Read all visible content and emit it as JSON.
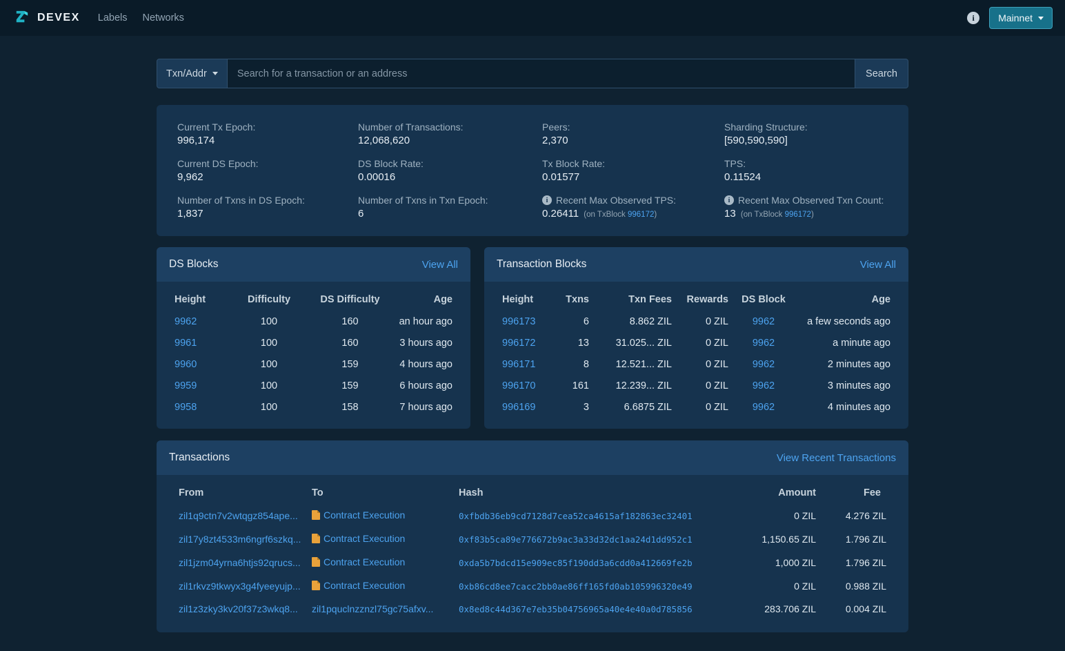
{
  "colors": {
    "accent_link": "#4da3ef",
    "network_button": "#17718a",
    "contract_icon": "#e9a23b",
    "card_bg": "#16334e",
    "card_header_bg": "#1d4062"
  },
  "navbar": {
    "brand": "DEVEX",
    "links": [
      {
        "label": "Labels"
      },
      {
        "label": "Networks"
      }
    ],
    "info_icon": "info-circle-icon",
    "network_button": "Mainnet"
  },
  "search": {
    "filter_label": "Txn/Addr",
    "placeholder": "Search for a transaction or an address",
    "button_label": "Search"
  },
  "stats": {
    "cells": [
      {
        "label": "Current Tx Epoch:",
        "value": "996,174"
      },
      {
        "label": "Number of Transactions:",
        "value": "12,068,620"
      },
      {
        "label": "Peers:",
        "value": "2,370"
      },
      {
        "label": "Sharding Structure:",
        "value": "[590,590,590]"
      },
      {
        "label": "Current DS Epoch:",
        "value": "9,962"
      },
      {
        "label": "DS Block Rate:",
        "value": "0.00016"
      },
      {
        "label": "Tx Block Rate:",
        "value": "0.01577"
      },
      {
        "label": "TPS:",
        "value": "0.11524"
      },
      {
        "label": "Number of Txns in DS Epoch:",
        "value": "1,837"
      },
      {
        "label": "Number of Txns in Txn Epoch:",
        "value": "6"
      },
      {
        "label": "Recent Max Observed TPS:",
        "value": "0.26411",
        "note_pre": "(on TxBlock",
        "note_link": "996172",
        "note_post": ")"
      },
      {
        "label": "Recent Max Observed Txn Count:",
        "value": "13",
        "note_pre": "(on TxBlock",
        "note_link": "996172",
        "note_post": ")"
      }
    ]
  },
  "ds_blocks": {
    "title": "DS Blocks",
    "view_all": "View All",
    "columns": [
      "Height",
      "Difficulty",
      "DS Difficulty",
      "Age"
    ],
    "rows": [
      {
        "height": "9962",
        "difficulty": "100",
        "ds_difficulty": "160",
        "age": "an hour ago"
      },
      {
        "height": "9961",
        "difficulty": "100",
        "ds_difficulty": "160",
        "age": "3 hours ago"
      },
      {
        "height": "9960",
        "difficulty": "100",
        "ds_difficulty": "159",
        "age": "4 hours ago"
      },
      {
        "height": "9959",
        "difficulty": "100",
        "ds_difficulty": "159",
        "age": "6 hours ago"
      },
      {
        "height": "9958",
        "difficulty": "100",
        "ds_difficulty": "158",
        "age": "7 hours ago"
      }
    ]
  },
  "tx_blocks": {
    "title": "Transaction Blocks",
    "view_all": "View All",
    "columns": [
      "Height",
      "Txns",
      "Txn Fees",
      "Rewards",
      "DS Block",
      "Age"
    ],
    "rows": [
      {
        "height": "996173",
        "txns": "6",
        "fees": "8.862 ZIL",
        "rewards": "0 ZIL",
        "ds_block": "9962",
        "age": "a few seconds ago"
      },
      {
        "height": "996172",
        "txns": "13",
        "fees": "31.025... ZIL",
        "rewards": "0 ZIL",
        "ds_block": "9962",
        "age": "a minute ago"
      },
      {
        "height": "996171",
        "txns": "8",
        "fees": "12.521... ZIL",
        "rewards": "0 ZIL",
        "ds_block": "9962",
        "age": "2 minutes ago"
      },
      {
        "height": "996170",
        "txns": "161",
        "fees": "12.239... ZIL",
        "rewards": "0 ZIL",
        "ds_block": "9962",
        "age": "3 minutes ago"
      },
      {
        "height": "996169",
        "txns": "3",
        "fees": "6.6875 ZIL",
        "rewards": "0 ZIL",
        "ds_block": "9962",
        "age": "4 minutes ago"
      }
    ]
  },
  "transactions": {
    "title": "Transactions",
    "view_link": "View Recent Transactions",
    "columns": [
      "From",
      "To",
      "Hash",
      "Amount",
      "Fee"
    ],
    "contract_label": "Contract Execution",
    "rows": [
      {
        "from": "zil1q9ctn7v2wtqgz854ape...",
        "to": "Contract Execution",
        "to_is_contract": true,
        "hash": "0xfbdb36eb9cd7128d7cea52ca4615af182863ec32401",
        "amount": "0 ZIL",
        "fee": "4.276 ZIL"
      },
      {
        "from": "zil17y8zt4533m6ngrf6szkq...",
        "to": "Contract Execution",
        "to_is_contract": true,
        "hash": "0xf83b5ca89e776672b9ac3a33d32dc1aa24d1dd952c1",
        "amount": "1,150.65 ZIL",
        "fee": "1.796 ZIL"
      },
      {
        "from": "zil1jzm04yrna6htjs92qrucs...",
        "to": "Contract Execution",
        "to_is_contract": true,
        "hash": "0xda5b7bdcd15e909ec85f190dd3a6cdd0a412669fe2b",
        "amount": "1,000 ZIL",
        "fee": "1.796 ZIL"
      },
      {
        "from": "zil1rkvz9tkwyx3g4fyeeyujp...",
        "to": "Contract Execution",
        "to_is_contract": true,
        "hash": "0xb86cd8ee7cacc2bb0ae86ff165fd0ab105996320e49",
        "amount": "0 ZIL",
        "fee": "0.988 ZIL"
      },
      {
        "from": "zil1z3zky3kv20f37z3wkq8...",
        "to": "zil1pquclnzznzl75gc75afxv...",
        "to_is_contract": false,
        "hash": "0x8ed8c44d367e7eb35b04756965a40e4e40a0d785856",
        "amount": "283.706 ZIL",
        "fee": "0.004 ZIL"
      }
    ]
  }
}
